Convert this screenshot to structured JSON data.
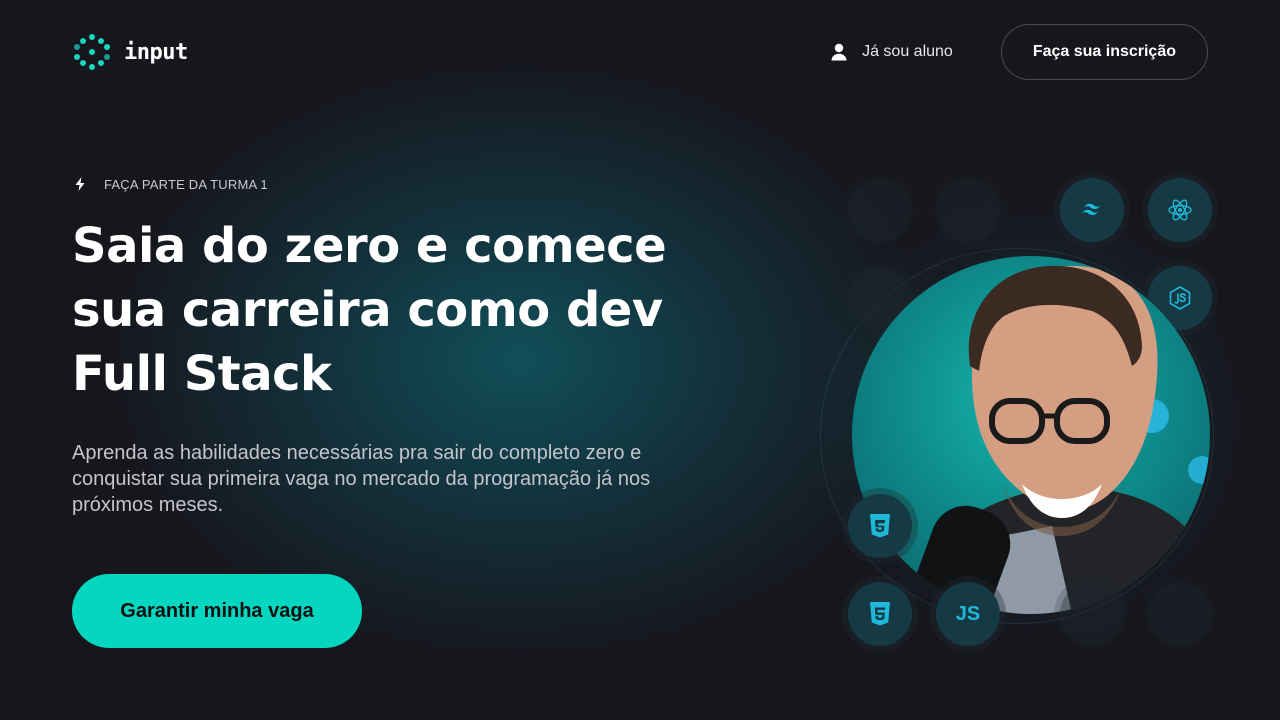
{
  "header": {
    "logo_text": "input",
    "login_label": "Já sou aluno",
    "signup_label": "Faça sua inscrição"
  },
  "hero": {
    "eyebrow": "FAÇA PARTE DA TURMA 1",
    "title": "Saia do zero e comece sua carreira como dev Full Stack",
    "description": "Aprenda as habilidades necessárias pra sair do completo zero e conquistar sua primeira vaga no mercado da programação já nos próximos meses.",
    "cta_label": "Garantir minha vaga"
  },
  "tech_icons": {
    "tailwind": "tailwind-icon",
    "react": "react-icon",
    "node": "nodejs-icon",
    "css": "css3-icon",
    "html": "html5-icon",
    "js": "js-icon",
    "js_label": "JS"
  },
  "colors": {
    "accent": "#05d6bf",
    "background": "#17161d",
    "tech_icon": "#1fb8d8"
  }
}
